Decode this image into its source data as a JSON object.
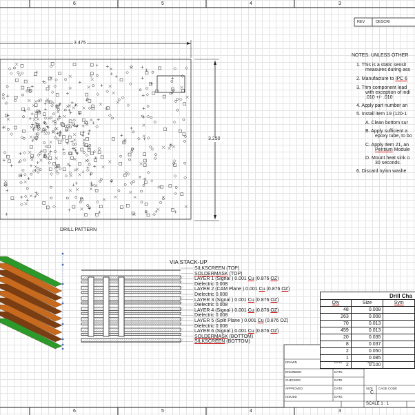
{
  "zones_top": [
    "6",
    "5",
    "4",
    "3"
  ],
  "zones_bottom": [
    "6",
    "5",
    "4",
    "3"
  ],
  "rev": {
    "col_rev": "REV",
    "col_desc": "DESCRI"
  },
  "dimension": {
    "width": "3.475",
    "height": "3.250"
  },
  "drill_pattern_label": "DRILL PATTERN",
  "notes": {
    "title": "NOTES: UNLESS OTHER",
    "n1a": "1.   This is a static sensit",
    "n1b": "measures during ass",
    "n2a": "2.   Manufacture to ",
    "n2b": "IPC 6",
    "n3a": "3.   Trim component lead",
    "n3b": "with exception of indi",
    "n3c": ".010 +/- .010",
    "n4": "4.   Apply part number an",
    "n5": "5.   Install item 19 (120-1",
    "nA": "A.   Clean bottom sur",
    "nB1": "B.   Apply sufficient a",
    "nB2": "epoxy tube, to bo",
    "nC1": "C.   Apply Item 21, an",
    "nC2a": "Pentium",
    "nC2b": " Module",
    "nD1": "D.   Mount heat sink o",
    "nD2": "30 seconds.",
    "n6": "6.   Discard nylon washe"
  },
  "drill_chart": {
    "title": "Drill Cha",
    "headers": [
      "Qty",
      "Size",
      "Sym"
    ],
    "rows": [
      {
        "qty": "48",
        "size": "0.008"
      },
      {
        "qty": "263",
        "size": "0.008"
      },
      {
        "qty": "70",
        "size": "0.013"
      },
      {
        "qty": "459",
        "size": "0.013"
      },
      {
        "qty": "20",
        "size": "0.035"
      },
      {
        "qty": "8",
        "size": "0.037"
      },
      {
        "qty": "2",
        "size": "0.050"
      },
      {
        "qty": "1",
        "size": "0.085"
      },
      {
        "qty": "2",
        "size": "0.100"
      }
    ]
  },
  "via": {
    "title": "VIA STACK-UP",
    "layers": [
      {
        "pre": "SILKSCREEN (TOP)",
        "u": ""
      },
      {
        "pre": "",
        "u": "SOLDERMASK",
        "post": " (TOP)"
      },
      {
        "pre": "LAYER 1 (Signal ) 0.001 ",
        "u": "Cu",
        "post": " (0.876 ",
        "u2": "OZ",
        "post2": ")"
      },
      {
        "pre": "Dielectric 0.008",
        "u": ""
      },
      {
        "pre": "LAYER 2 (CAM Plane ) 0.001 ",
        "u": "Cu",
        "post": " (0.876 ",
        "u2": "OZ",
        "post2": ")"
      },
      {
        "pre": "Dielectric 0.008",
        "u": ""
      },
      {
        "pre": "LAYER 3 (Signal ) 0.001 ",
        "u": "Cu",
        "post": " (0.876 ",
        "u2": "OZ",
        "post2": ")"
      },
      {
        "pre": "Dielectric 0.008",
        "u": ""
      },
      {
        "pre": "LAYER 4 (Signal ) 0.001 ",
        "u": "Cu",
        "post": " (0.876 ",
        "u2": "OZ",
        "post2": ")"
      },
      {
        "pre": "Dielectric 0.008",
        "u": ""
      },
      {
        "pre": "LAYER 5 (Split Plane ) 0.001 ",
        "u": "Cu",
        "post": " (0.876 OZ)"
      },
      {
        "pre": "Dielectric 0.008",
        "u": ""
      },
      {
        "pre": "LAYER 6 (Signal ) 0.001 ",
        "u": "Cu",
        "post": " (0.876 ",
        "u2": "OZ",
        "post2": ")"
      },
      {
        "pre": "",
        "u": "SOLDERMASK",
        "post": " (BOTTOM)"
      },
      {
        "pre": "",
        "u": "SILKSCREEN",
        "post": " (BOTTOM)"
      }
    ]
  },
  "title_block": {
    "drawn": "DRAWN",
    "date1": "DATE",
    "title": "TITLE",
    "engineer": "ENGINEER",
    "date2": "DATE",
    "checked": "CHECKED",
    "date3": "DATE",
    "approved": "APPROVED",
    "date4": "DATE",
    "issued": "ISSUED",
    "date5": "DATE",
    "size_label": "SIZE",
    "cage_label": "CAGE CODE",
    "size_value": "C",
    "scale": "SCALE 1 : 1"
  },
  "colors": {
    "accent": "#c00000",
    "line": "#222222",
    "copper": "#c86a1e",
    "green": "#2b9a2b"
  }
}
